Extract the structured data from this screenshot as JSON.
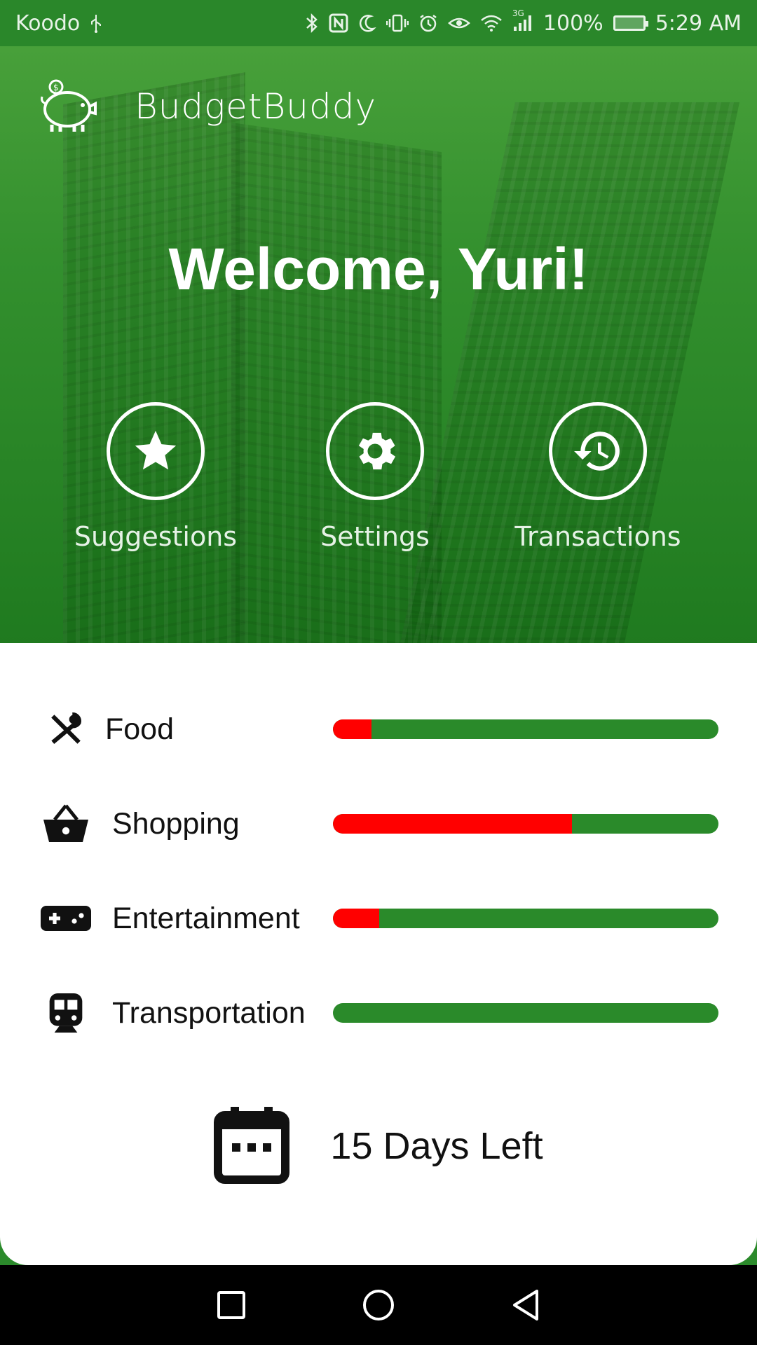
{
  "status_bar": {
    "carrier": "Koodo",
    "network": "3G",
    "battery": "100%",
    "time": "5:29 AM"
  },
  "header": {
    "app_title": "BudgetBuddy"
  },
  "hero": {
    "welcome": "Welcome, Yuri!"
  },
  "actions": [
    {
      "label": "Suggestions",
      "icon": "star-icon"
    },
    {
      "label": "Settings",
      "icon": "gear-icon"
    },
    {
      "label": "Transactions",
      "icon": "history-icon"
    }
  ],
  "categories": [
    {
      "label": "Food",
      "icon": "fork-spoon-icon",
      "spent_fraction": 0.1
    },
    {
      "label": "Shopping",
      "icon": "basket-icon",
      "spent_fraction": 0.62
    },
    {
      "label": "Entertainment",
      "icon": "gamepad-icon",
      "spent_fraction": 0.12
    },
    {
      "label": "Transportation",
      "icon": "train-icon",
      "spent_fraction": 0.0
    }
  ],
  "days_left": {
    "text": "15 Days Left",
    "icon": "calendar-icon"
  },
  "colors": {
    "brand_green": "#2a8a2a",
    "spent_red": "#ff0000"
  }
}
